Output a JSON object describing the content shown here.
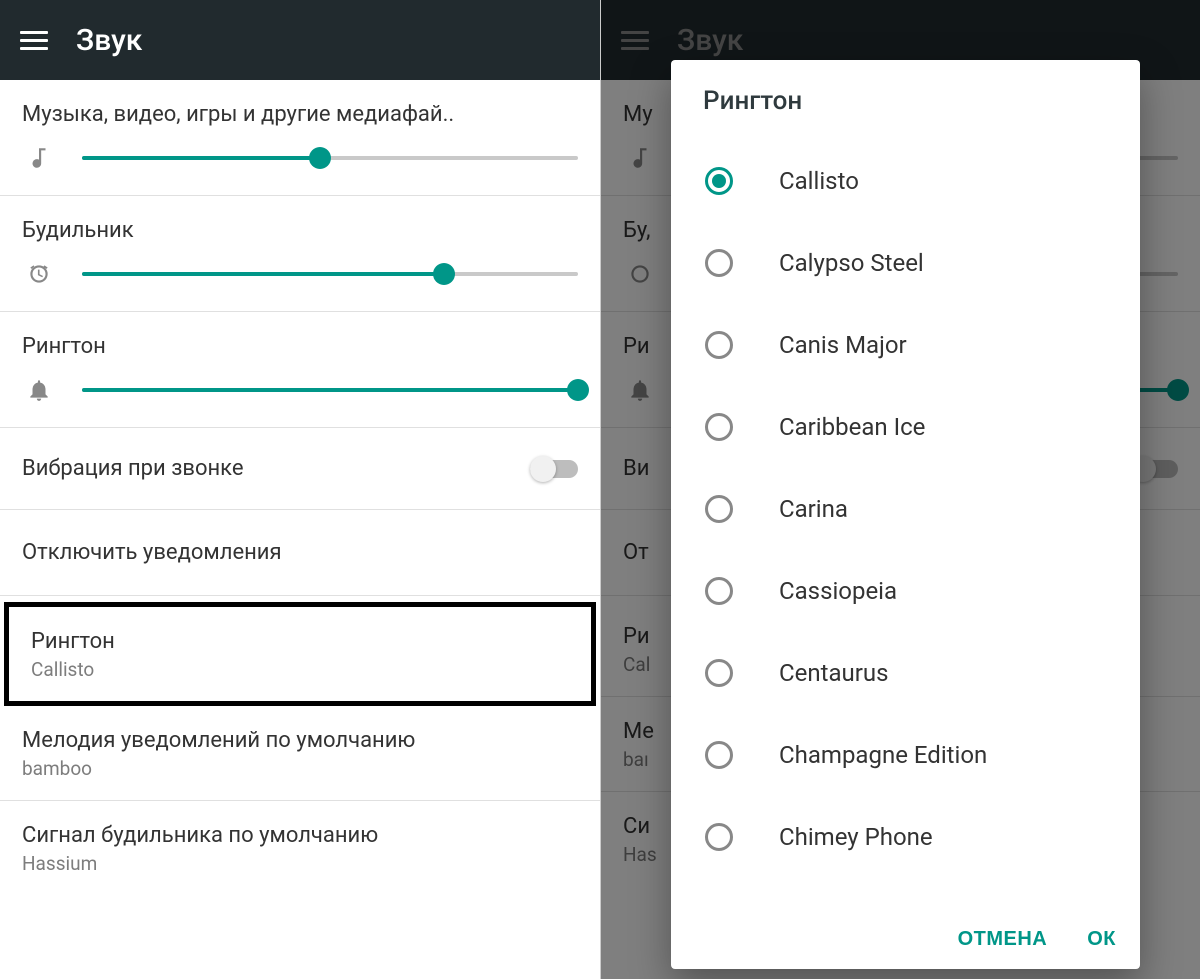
{
  "colors": {
    "accent": "#009688"
  },
  "left": {
    "title": "Звук",
    "media": {
      "label": "Музыка, видео, игры и другие медиафай..",
      "value": 48,
      "icon": "note-icon"
    },
    "alarm": {
      "label": "Будильник",
      "value": 73,
      "icon": "alarm-icon"
    },
    "ringtone_vol": {
      "label": "Рингтон",
      "value": 100,
      "icon": "bell-icon"
    },
    "vibrate": {
      "label": "Вибрация при звонке",
      "on": false
    },
    "dnd": {
      "label": "Отключить уведомления"
    },
    "ringtone_sel": {
      "label": "Рингтон",
      "value": "Callisto"
    },
    "notif_sound": {
      "label": "Мелодия уведомлений по умолчанию",
      "value": "bamboo"
    },
    "alarm_sound": {
      "label": "Сигнал будильника по умолчанию",
      "value": "Hassium"
    }
  },
  "right": {
    "title": "Звук",
    "media_peek": "Му",
    "alarm_peek": "Бу,",
    "ringtone_peek": "Ри",
    "vibrate_peek": "Ви",
    "dnd_peek": "От",
    "ringtone_sel_peek": {
      "label": "Ри",
      "value": "Cal"
    },
    "notif_sound_peek": {
      "label": "Ме",
      "value": "baı"
    },
    "alarm_sound_peek": {
      "label": "Си",
      "value": "Has"
    }
  },
  "dialog": {
    "title": "Рингтон",
    "items": [
      {
        "label": "Callisto",
        "selected": true
      },
      {
        "label": "Calypso Steel",
        "selected": false
      },
      {
        "label": "Canis Major",
        "selected": false
      },
      {
        "label": "Caribbean Ice",
        "selected": false
      },
      {
        "label": "Carina",
        "selected": false
      },
      {
        "label": "Cassiopeia",
        "selected": false
      },
      {
        "label": "Centaurus",
        "selected": false
      },
      {
        "label": "Champagne Edition",
        "selected": false
      },
      {
        "label": "Chimey Phone",
        "selected": false
      }
    ],
    "cancel": "ОТМЕНА",
    "ok": "ОК"
  }
}
